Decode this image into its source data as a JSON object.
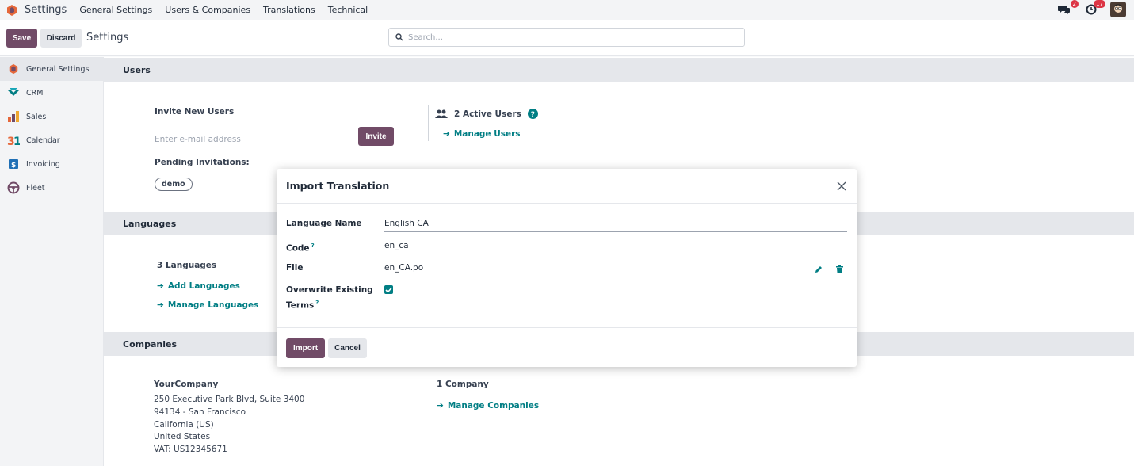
{
  "navbar": {
    "app_name": "Settings",
    "menu": [
      "General Settings",
      "Users & Companies",
      "Translations",
      "Technical"
    ],
    "messages_badge": "2",
    "activities_badge": "17",
    "icons": [
      "odoo-logo-icon",
      "chat-icon",
      "clock-icon",
      "avatar"
    ]
  },
  "control_panel": {
    "save_label": "Save",
    "discard_label": "Discard",
    "title": "Settings",
    "search_placeholder": "Search..."
  },
  "sidebar": {
    "items": [
      {
        "label": "General Settings",
        "icon": "general-settings-icon",
        "active": true
      },
      {
        "label": "CRM",
        "icon": "crm-icon"
      },
      {
        "label": "Sales",
        "icon": "sales-icon"
      },
      {
        "label": "Calendar",
        "icon": "calendar-icon"
      },
      {
        "label": "Invoicing",
        "icon": "invoicing-icon"
      },
      {
        "label": "Fleet",
        "icon": "fleet-icon"
      }
    ]
  },
  "users": {
    "header": "Users",
    "invite_title": "Invite New Users",
    "email_placeholder": "Enter e-mail address",
    "invite_label": "Invite",
    "pending_title": "Pending Invitations:",
    "pending_chip": "demo",
    "active_users": "2 Active Users",
    "manage_users": "Manage Users"
  },
  "languages": {
    "header": "Languages",
    "count": "3 Languages",
    "add": "Add Languages",
    "manage": "Manage Languages"
  },
  "companies": {
    "header": "Companies",
    "name": "YourCompany",
    "address_lines": [
      "250 Executive Park Blvd, Suite 3400",
      "94134 - San Francisco",
      "California (US)",
      "United States",
      "VAT:  US12345671"
    ],
    "count": "1 Company",
    "manage": "Manage Companies"
  },
  "modal": {
    "title": "Import Translation",
    "language_name_label": "Language Name",
    "language_name_value": "English CA",
    "code_label": "Code",
    "code_help": "?",
    "code_value": "en_ca",
    "file_label": "File",
    "file_value": "en_CA.po",
    "overwrite_label_line1": "Overwrite Existing",
    "overwrite_label_line2": "Terms",
    "overwrite_help": "?",
    "overwrite_checked": true,
    "import_label": "Import",
    "cancel_label": "Cancel"
  },
  "colors": {
    "primary": "#714b67",
    "link": "#017e84",
    "badge": "#dc3545"
  }
}
